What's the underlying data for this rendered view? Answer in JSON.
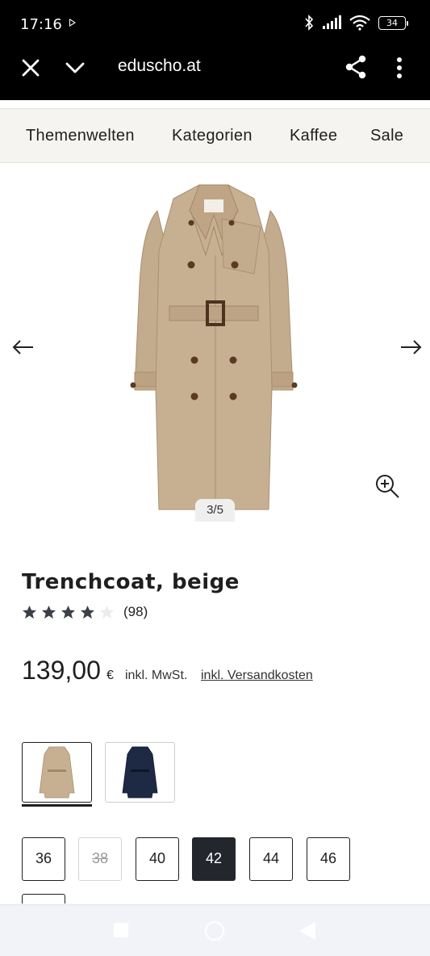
{
  "status_bar": {
    "time": "17:16",
    "battery": "34"
  },
  "browser": {
    "url": "eduscho.at"
  },
  "nav": {
    "items": [
      "Themenwelten",
      "Kategorien",
      "Kaffee",
      "Sale"
    ]
  },
  "gallery": {
    "counter": "3/5"
  },
  "product": {
    "title": "Trenchcoat, beige",
    "rating": 4,
    "rating_max": 5,
    "review_count": "(98)",
    "price": "139,00",
    "currency": "€",
    "vat_note": "inkl. MwSt.",
    "shipping_link": "inkl. Versandkosten"
  },
  "variants": {
    "colors": [
      "#c7b092",
      "#1e2a44"
    ],
    "selected_index": 0
  },
  "sizes": {
    "options": [
      "36",
      "38",
      "40",
      "42",
      "44",
      "46"
    ],
    "unavailable": [
      "38"
    ],
    "selected": "42"
  },
  "colors": {
    "accent_dark": "#23272d",
    "coat_beige": "#c7b092",
    "coat_navy": "#1e2a44"
  }
}
